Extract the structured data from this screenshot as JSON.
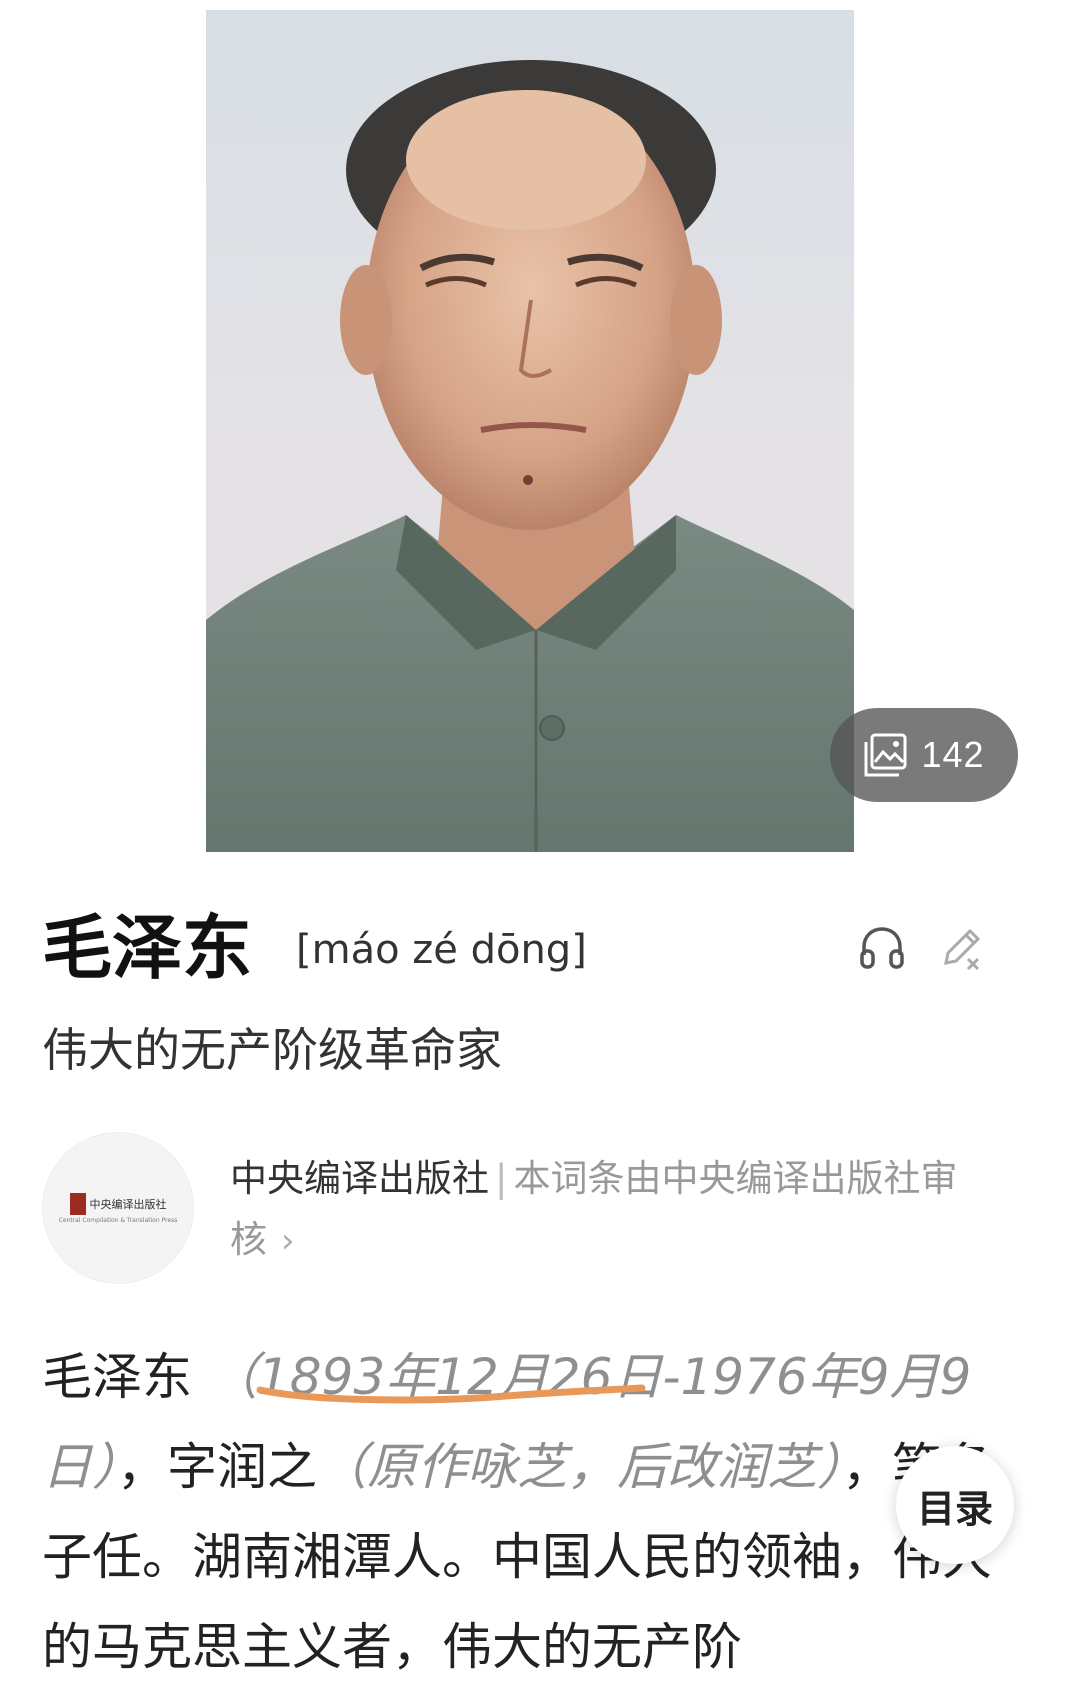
{
  "media": {
    "image_alt": "毛泽东",
    "gallery_count": "142"
  },
  "entry": {
    "title": "毛泽东",
    "pinyin": "[máo zé dōng]",
    "subtitle": "伟大的无产阶级革命家"
  },
  "publisher": {
    "name": "中央编译出版社",
    "separator": "|",
    "review_note": "本词条由中央编译出版社审核",
    "logo_text": "中央编译出版社",
    "logo_sub": "Central Compilation & Translation Press",
    "chevron": "›"
  },
  "article": {
    "name": "毛泽东",
    "dates_open": "（",
    "birth": "1893年12月26日",
    "dates_rest": "-1976年9月9日）",
    "comma1": "，",
    "courtesy": "字润之",
    "courtesy_note": "（原作咏芝，后改润芝）",
    "rest": "，笔名子任。湖南湘潭人。中国人民的领袖，伟大的马克思主义者，伟大的无产阶"
  },
  "toc": {
    "label": "目录"
  },
  "colors": {
    "underline": "#e8995a",
    "badge_bg": "#555555",
    "note_text": "#8f8f8f"
  },
  "icons": {
    "gallery": "image-gallery-icon",
    "audio": "headphones-icon",
    "edit": "edit-pen-icon",
    "chevron": "chevron-right-icon"
  }
}
